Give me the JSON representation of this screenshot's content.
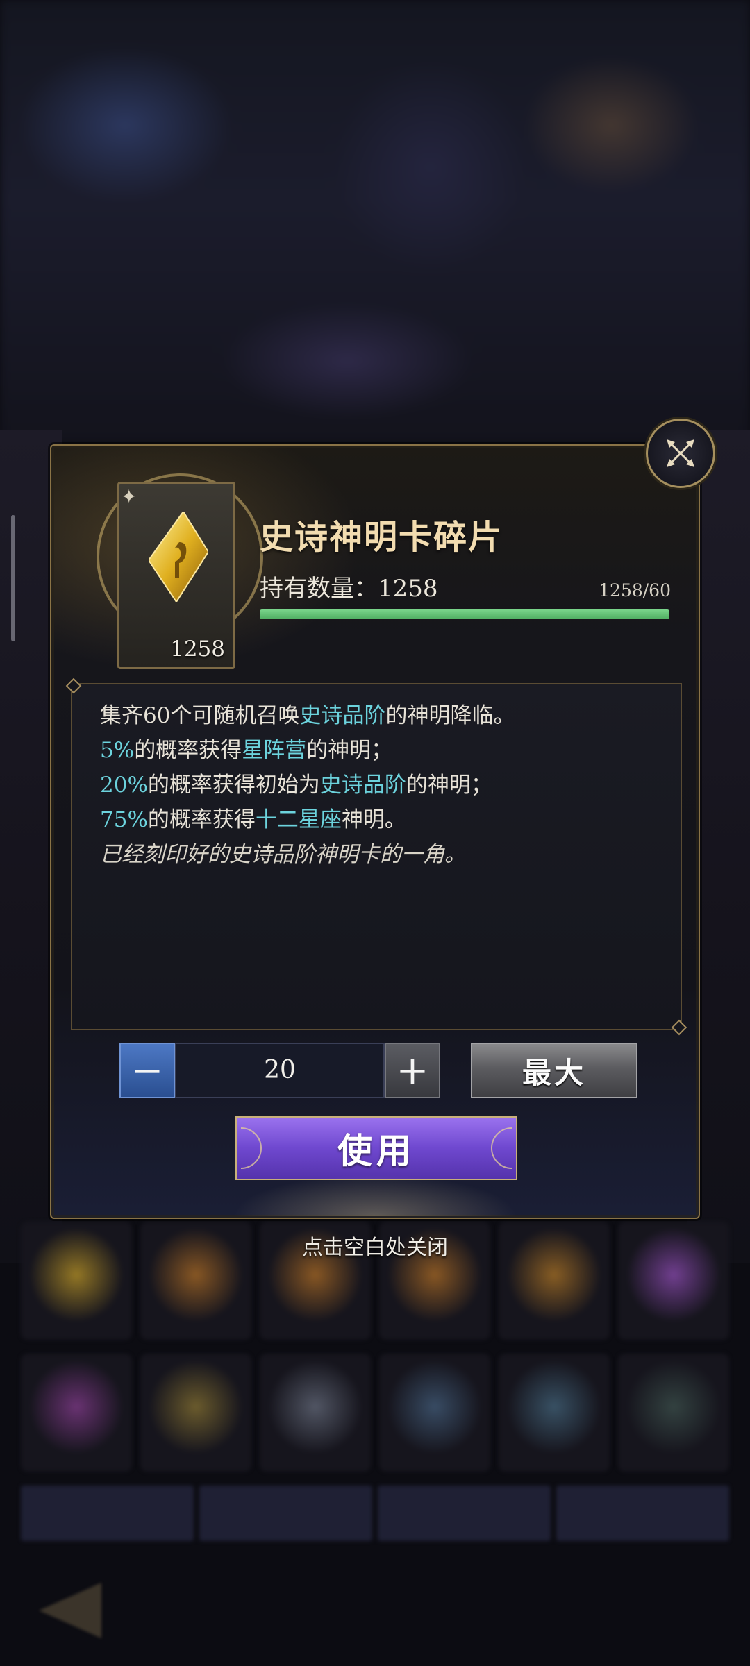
{
  "dialog": {
    "title": "史诗神明卡碎片",
    "item_count": "1258",
    "quantity_label": "持有数量：1258",
    "progress_text": "1258/60",
    "progress_fraction": 1.0,
    "description": {
      "line1_a": "集齐60个可随机召唤",
      "line1_hl": "史诗品阶",
      "line1_b": "的神明降临。",
      "line2_hl1": "5%",
      "line2_a": "的概率获得",
      "line2_hl2": "星阵营",
      "line2_b": "的神明；",
      "line3_hl1": "20%",
      "line3_a": "的概率获得初始为",
      "line3_hl2": "史诗品阶",
      "line3_b": "的神明；",
      "line4_hl1": "75%",
      "line4_a": "的概率获得",
      "line4_hl2": "十二星座",
      "line4_b": "神明。",
      "flavor": "已经刻印好的史诗品阶神明卡的一角。"
    },
    "stepper": {
      "minus_label": "−",
      "value": "20",
      "plus_label": "+"
    },
    "max_label": "最大",
    "use_label": "使用",
    "close_icon": "close-compass-icon"
  },
  "close_hint": "点击空白处关闭",
  "colors": {
    "highlight": "#6cd3dd",
    "progress": "#5fc06f",
    "use_button": "#7a52d8",
    "gold_border": "#8a7346"
  }
}
